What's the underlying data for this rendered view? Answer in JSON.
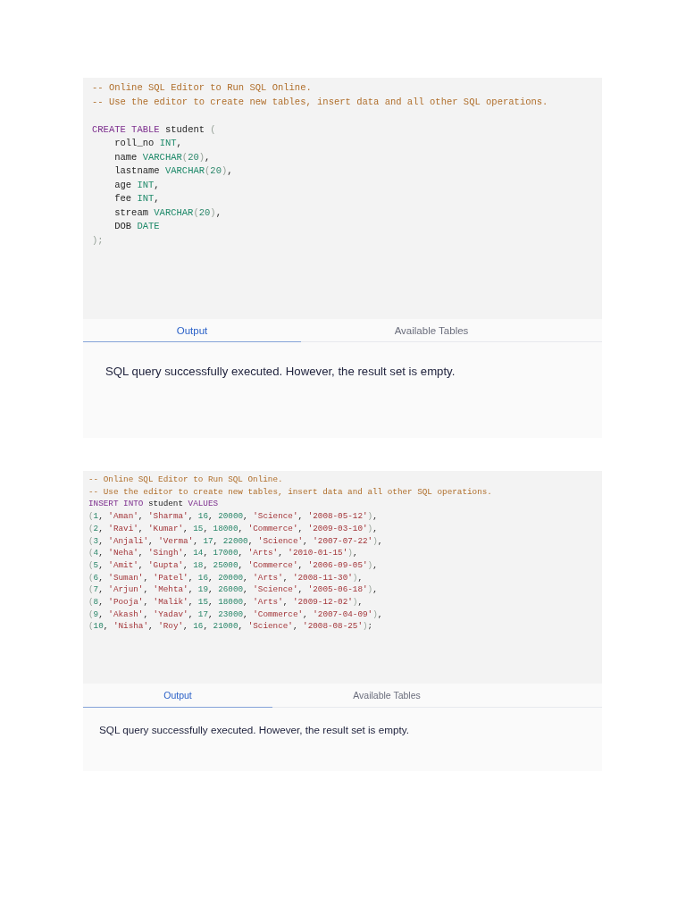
{
  "editors": [
    {
      "code_blocks": [
        {
          "lines": [
            {
              "tokens": [
                {
                  "kind": "comment",
                  "text": "-- Online SQL Editor to Run SQL Online."
                }
              ]
            },
            {
              "tokens": [
                {
                  "kind": "comment",
                  "text": "-- Use the editor to create new tables, insert data and all other SQL operations."
                }
              ]
            }
          ]
        },
        {
          "lines": [
            {
              "tokens": [
                {
                  "kind": "keyword",
                  "text": "CREATE TABLE"
                },
                {
                  "kind": "plain",
                  "text": " student "
                },
                {
                  "kind": "punct",
                  "text": "("
                }
              ],
              "children": [
                {
                  "tokens": [
                    {
                      "kind": "plain",
                      "text": "roll_no "
                    },
                    {
                      "kind": "type",
                      "text": "INT"
                    },
                    {
                      "kind": "plain",
                      "text": ","
                    }
                  ]
                },
                {
                  "tokens": [
                    {
                      "kind": "plain",
                      "text": "name "
                    },
                    {
                      "kind": "type",
                      "text": "VARCHAR"
                    },
                    {
                      "kind": "punct",
                      "text": "("
                    },
                    {
                      "kind": "number",
                      "text": "20"
                    },
                    {
                      "kind": "punct",
                      "text": ")"
                    },
                    {
                      "kind": "plain",
                      "text": ","
                    }
                  ]
                },
                {
                  "tokens": [
                    {
                      "kind": "plain",
                      "text": "lastname "
                    },
                    {
                      "kind": "type",
                      "text": "VARCHAR"
                    },
                    {
                      "kind": "punct",
                      "text": "("
                    },
                    {
                      "kind": "number",
                      "text": "20"
                    },
                    {
                      "kind": "punct",
                      "text": ")"
                    },
                    {
                      "kind": "plain",
                      "text": ","
                    }
                  ]
                },
                {
                  "tokens": [
                    {
                      "kind": "plain",
                      "text": "age "
                    },
                    {
                      "kind": "type",
                      "text": "INT"
                    },
                    {
                      "kind": "plain",
                      "text": ","
                    }
                  ]
                },
                {
                  "tokens": [
                    {
                      "kind": "plain",
                      "text": "fee "
                    },
                    {
                      "kind": "type",
                      "text": "INT"
                    },
                    {
                      "kind": "plain",
                      "text": ","
                    }
                  ]
                },
                {
                  "tokens": [
                    {
                      "kind": "plain",
                      "text": "stream "
                    },
                    {
                      "kind": "type",
                      "text": "VARCHAR"
                    },
                    {
                      "kind": "punct",
                      "text": "("
                    },
                    {
                      "kind": "number",
                      "text": "20"
                    },
                    {
                      "kind": "punct",
                      "text": ")"
                    },
                    {
                      "kind": "plain",
                      "text": ","
                    }
                  ]
                },
                {
                  "tokens": [
                    {
                      "kind": "plain",
                      "text": "DOB "
                    },
                    {
                      "kind": "type",
                      "text": "DATE"
                    }
                  ]
                }
              ]
            },
            {
              "tokens": [
                {
                  "kind": "punct",
                  "text": ");"
                }
              ]
            }
          ]
        }
      ],
      "tabs": [
        {
          "label": "Output",
          "selected": true
        },
        {
          "label": "Available Tables",
          "selected": false
        }
      ],
      "message": "SQL query successfully executed. However, the result set is empty."
    },
    {
      "code_blocks": [
        {
          "lines": [
            {
              "tokens": [
                {
                  "kind": "comment",
                  "text": "-- Online SQL Editor to Run SQL Online."
                }
              ]
            },
            {
              "tokens": [
                {
                  "kind": "comment",
                  "text": "-- Use the editor to create new tables, insert data and all other SQL operations."
                }
              ]
            },
            {
              "tokens": [
                {
                  "kind": "keyword",
                  "text": "INSERT INTO"
                },
                {
                  "kind": "plain",
                  "text": " student "
                },
                {
                  "kind": "keyword",
                  "text": "VALUES"
                }
              ]
            },
            {
              "tokens": [
                {
                  "kind": "punct",
                  "text": "("
                },
                {
                  "kind": "number",
                  "text": "1"
                },
                {
                  "kind": "plain",
                  "text": ", "
                },
                {
                  "kind": "string",
                  "text": "'Aman'"
                },
                {
                  "kind": "plain",
                  "text": ", "
                },
                {
                  "kind": "string",
                  "text": "'Sharma'"
                },
                {
                  "kind": "plain",
                  "text": ", "
                },
                {
                  "kind": "number",
                  "text": "16"
                },
                {
                  "kind": "plain",
                  "text": ", "
                },
                {
                  "kind": "number",
                  "text": "20000"
                },
                {
                  "kind": "plain",
                  "text": ", "
                },
                {
                  "kind": "string",
                  "text": "'Science'"
                },
                {
                  "kind": "plain",
                  "text": ", "
                },
                {
                  "kind": "string",
                  "text": "'2008-05-12'"
                },
                {
                  "kind": "punct",
                  "text": ")"
                },
                {
                  "kind": "plain",
                  "text": ","
                }
              ]
            },
            {
              "tokens": [
                {
                  "kind": "punct",
                  "text": "("
                },
                {
                  "kind": "number",
                  "text": "2"
                },
                {
                  "kind": "plain",
                  "text": ", "
                },
                {
                  "kind": "string",
                  "text": "'Ravi'"
                },
                {
                  "kind": "plain",
                  "text": ", "
                },
                {
                  "kind": "string",
                  "text": "'Kumar'"
                },
                {
                  "kind": "plain",
                  "text": ", "
                },
                {
                  "kind": "number",
                  "text": "15"
                },
                {
                  "kind": "plain",
                  "text": ", "
                },
                {
                  "kind": "number",
                  "text": "18000"
                },
                {
                  "kind": "plain",
                  "text": ", "
                },
                {
                  "kind": "string",
                  "text": "'Commerce'"
                },
                {
                  "kind": "plain",
                  "text": ", "
                },
                {
                  "kind": "string",
                  "text": "'2009-03-10'"
                },
                {
                  "kind": "punct",
                  "text": ")"
                },
                {
                  "kind": "plain",
                  "text": ","
                }
              ]
            },
            {
              "tokens": [
                {
                  "kind": "punct",
                  "text": "("
                },
                {
                  "kind": "number",
                  "text": "3"
                },
                {
                  "kind": "plain",
                  "text": ", "
                },
                {
                  "kind": "string",
                  "text": "'Anjali'"
                },
                {
                  "kind": "plain",
                  "text": ", "
                },
                {
                  "kind": "string",
                  "text": "'Verma'"
                },
                {
                  "kind": "plain",
                  "text": ", "
                },
                {
                  "kind": "number",
                  "text": "17"
                },
                {
                  "kind": "plain",
                  "text": ", "
                },
                {
                  "kind": "number",
                  "text": "22000"
                },
                {
                  "kind": "plain",
                  "text": ", "
                },
                {
                  "kind": "string",
                  "text": "'Science'"
                },
                {
                  "kind": "plain",
                  "text": ", "
                },
                {
                  "kind": "string",
                  "text": "'2007-07-22'"
                },
                {
                  "kind": "punct",
                  "text": ")"
                },
                {
                  "kind": "plain",
                  "text": ","
                }
              ]
            },
            {
              "tokens": [
                {
                  "kind": "punct",
                  "text": "("
                },
                {
                  "kind": "number",
                  "text": "4"
                },
                {
                  "kind": "plain",
                  "text": ", "
                },
                {
                  "kind": "string",
                  "text": "'Neha'"
                },
                {
                  "kind": "plain",
                  "text": ", "
                },
                {
                  "kind": "string",
                  "text": "'Singh'"
                },
                {
                  "kind": "plain",
                  "text": ", "
                },
                {
                  "kind": "number",
                  "text": "14"
                },
                {
                  "kind": "plain",
                  "text": ", "
                },
                {
                  "kind": "number",
                  "text": "17000"
                },
                {
                  "kind": "plain",
                  "text": ", "
                },
                {
                  "kind": "string",
                  "text": "'Arts'"
                },
                {
                  "kind": "plain",
                  "text": ", "
                },
                {
                  "kind": "string",
                  "text": "'2010-01-15'"
                },
                {
                  "kind": "punct",
                  "text": ")"
                },
                {
                  "kind": "plain",
                  "text": ","
                }
              ]
            },
            {
              "tokens": [
                {
                  "kind": "punct",
                  "text": "("
                },
                {
                  "kind": "number",
                  "text": "5"
                },
                {
                  "kind": "plain",
                  "text": ", "
                },
                {
                  "kind": "string",
                  "text": "'Amit'"
                },
                {
                  "kind": "plain",
                  "text": ", "
                },
                {
                  "kind": "string",
                  "text": "'Gupta'"
                },
                {
                  "kind": "plain",
                  "text": ", "
                },
                {
                  "kind": "number",
                  "text": "18"
                },
                {
                  "kind": "plain",
                  "text": ", "
                },
                {
                  "kind": "number",
                  "text": "25000"
                },
                {
                  "kind": "plain",
                  "text": ", "
                },
                {
                  "kind": "string",
                  "text": "'Commerce'"
                },
                {
                  "kind": "plain",
                  "text": ", "
                },
                {
                  "kind": "string",
                  "text": "'2006-09-05'"
                },
                {
                  "kind": "punct",
                  "text": ")"
                },
                {
                  "kind": "plain",
                  "text": ","
                }
              ]
            },
            {
              "tokens": [
                {
                  "kind": "punct",
                  "text": "("
                },
                {
                  "kind": "number",
                  "text": "6"
                },
                {
                  "kind": "plain",
                  "text": ", "
                },
                {
                  "kind": "string",
                  "text": "'Suman'"
                },
                {
                  "kind": "plain",
                  "text": ", "
                },
                {
                  "kind": "string",
                  "text": "'Patel'"
                },
                {
                  "kind": "plain",
                  "text": ", "
                },
                {
                  "kind": "number",
                  "text": "16"
                },
                {
                  "kind": "plain",
                  "text": ", "
                },
                {
                  "kind": "number",
                  "text": "20000"
                },
                {
                  "kind": "plain",
                  "text": ", "
                },
                {
                  "kind": "string",
                  "text": "'Arts'"
                },
                {
                  "kind": "plain",
                  "text": ", "
                },
                {
                  "kind": "string",
                  "text": "'2008-11-30'"
                },
                {
                  "kind": "punct",
                  "text": ")"
                },
                {
                  "kind": "plain",
                  "text": ","
                }
              ]
            },
            {
              "tokens": [
                {
                  "kind": "punct",
                  "text": "("
                },
                {
                  "kind": "number",
                  "text": "7"
                },
                {
                  "kind": "plain",
                  "text": ", "
                },
                {
                  "kind": "string",
                  "text": "'Arjun'"
                },
                {
                  "kind": "plain",
                  "text": ", "
                },
                {
                  "kind": "string",
                  "text": "'Mehta'"
                },
                {
                  "kind": "plain",
                  "text": ", "
                },
                {
                  "kind": "number",
                  "text": "19"
                },
                {
                  "kind": "plain",
                  "text": ", "
                },
                {
                  "kind": "number",
                  "text": "26000"
                },
                {
                  "kind": "plain",
                  "text": ", "
                },
                {
                  "kind": "string",
                  "text": "'Science'"
                },
                {
                  "kind": "plain",
                  "text": ", "
                },
                {
                  "kind": "string",
                  "text": "'2005-06-18'"
                },
                {
                  "kind": "punct",
                  "text": ")"
                },
                {
                  "kind": "plain",
                  "text": ","
                }
              ]
            },
            {
              "tokens": [
                {
                  "kind": "punct",
                  "text": "("
                },
                {
                  "kind": "number",
                  "text": "8"
                },
                {
                  "kind": "plain",
                  "text": ", "
                },
                {
                  "kind": "string",
                  "text": "'Pooja'"
                },
                {
                  "kind": "plain",
                  "text": ", "
                },
                {
                  "kind": "string",
                  "text": "'Malik'"
                },
                {
                  "kind": "plain",
                  "text": ", "
                },
                {
                  "kind": "number",
                  "text": "15"
                },
                {
                  "kind": "plain",
                  "text": ", "
                },
                {
                  "kind": "number",
                  "text": "18000"
                },
                {
                  "kind": "plain",
                  "text": ", "
                },
                {
                  "kind": "string",
                  "text": "'Arts'"
                },
                {
                  "kind": "plain",
                  "text": ", "
                },
                {
                  "kind": "string",
                  "text": "'2009-12-02'"
                },
                {
                  "kind": "punct",
                  "text": ")"
                },
                {
                  "kind": "plain",
                  "text": ","
                }
              ]
            },
            {
              "tokens": [
                {
                  "kind": "punct",
                  "text": "("
                },
                {
                  "kind": "number",
                  "text": "9"
                },
                {
                  "kind": "plain",
                  "text": ", "
                },
                {
                  "kind": "string",
                  "text": "'Akash'"
                },
                {
                  "kind": "plain",
                  "text": ", "
                },
                {
                  "kind": "string",
                  "text": "'Yadav'"
                },
                {
                  "kind": "plain",
                  "text": ", "
                },
                {
                  "kind": "number",
                  "text": "17"
                },
                {
                  "kind": "plain",
                  "text": ", "
                },
                {
                  "kind": "number",
                  "text": "23000"
                },
                {
                  "kind": "plain",
                  "text": ", "
                },
                {
                  "kind": "string",
                  "text": "'Commerce'"
                },
                {
                  "kind": "plain",
                  "text": ", "
                },
                {
                  "kind": "string",
                  "text": "'2007-04-09'"
                },
                {
                  "kind": "punct",
                  "text": ")"
                },
                {
                  "kind": "plain",
                  "text": ","
                }
              ]
            },
            {
              "tokens": [
                {
                  "kind": "punct",
                  "text": "("
                },
                {
                  "kind": "number",
                  "text": "10"
                },
                {
                  "kind": "plain",
                  "text": ", "
                },
                {
                  "kind": "string",
                  "text": "'Nisha'"
                },
                {
                  "kind": "plain",
                  "text": ", "
                },
                {
                  "kind": "string",
                  "text": "'Roy'"
                },
                {
                  "kind": "plain",
                  "text": ", "
                },
                {
                  "kind": "number",
                  "text": "16"
                },
                {
                  "kind": "plain",
                  "text": ", "
                },
                {
                  "kind": "number",
                  "text": "21000"
                },
                {
                  "kind": "plain",
                  "text": ", "
                },
                {
                  "kind": "string",
                  "text": "'Science'"
                },
                {
                  "kind": "plain",
                  "text": ", "
                },
                {
                  "kind": "string",
                  "text": "'2008-08-25'"
                },
                {
                  "kind": "punct",
                  "text": ")"
                },
                {
                  "kind": "plain",
                  "text": ";"
                }
              ]
            }
          ]
        }
      ],
      "tabs": [
        {
          "label": "Output",
          "selected": true
        },
        {
          "label": "Available Tables",
          "selected": false
        }
      ],
      "message": "SQL query successfully executed. However, the result set is empty."
    }
  ]
}
